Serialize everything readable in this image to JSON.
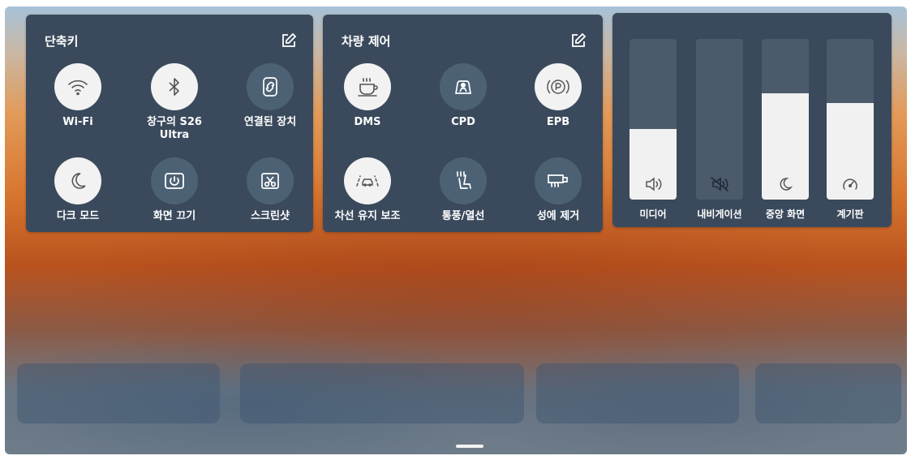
{
  "shortcuts": {
    "title": "단축키",
    "items": [
      {
        "label": "Wi-Fi",
        "state": "on",
        "icon": "wifi-icon"
      },
      {
        "label": "창구의 S26 Ultra",
        "state": "on",
        "icon": "bluetooth-icon"
      },
      {
        "label": "연결된 장치",
        "state": "off",
        "icon": "phone-link-icon"
      },
      {
        "label": "다크 모드",
        "state": "on",
        "icon": "moon-icon"
      },
      {
        "label": "화면 끄기",
        "state": "off",
        "icon": "power-icon"
      },
      {
        "label": "스크린샷",
        "state": "off",
        "icon": "screenshot-icon"
      }
    ]
  },
  "vehicle": {
    "title": "차량 제어",
    "items": [
      {
        "label": "DMS",
        "state": "on",
        "icon": "coffee-icon"
      },
      {
        "label": "CPD",
        "state": "off",
        "icon": "child-seat-icon"
      },
      {
        "label": "EPB",
        "state": "on",
        "icon": "parking-brake-icon"
      },
      {
        "label": "차선 유지 보조",
        "state": "on",
        "icon": "lane-keep-icon"
      },
      {
        "label": "통풍/열선",
        "state": "off",
        "icon": "seat-heat-icon"
      },
      {
        "label": "성에 제거",
        "state": "off",
        "icon": "defrost-icon"
      }
    ]
  },
  "sliders": [
    {
      "label": "미디어",
      "level": 0.44,
      "icon": "speaker-icon"
    },
    {
      "label": "내비게이션",
      "level": 0,
      "icon": "speaker-muted-icon"
    },
    {
      "label": "중앙 화면",
      "level": 0.66,
      "icon": "moon-icon"
    },
    {
      "label": "계기판",
      "level": 0.6,
      "icon": "gauge-icon"
    }
  ],
  "colors": {
    "panel": "#3a4a5c",
    "tile_on": "#f2f2f2",
    "tile_off": "#4d6175",
    "slider_track": "#4b5b6b",
    "slider_fill": "#f1f1f1"
  }
}
